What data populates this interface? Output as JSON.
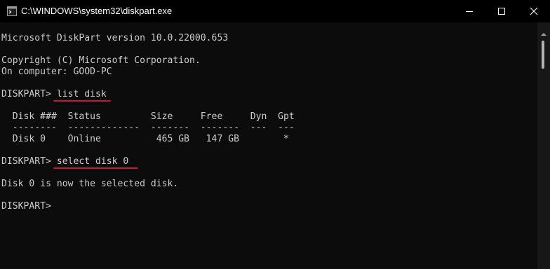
{
  "window": {
    "title": "C:\\WINDOWS\\system32\\diskpart.exe"
  },
  "icons": {
    "app": "console-app-icon",
    "minimize": "minimize-icon",
    "maximize": "maximize-icon",
    "close": "close-icon",
    "scroll_up": "chevron-up-icon"
  },
  "colors": {
    "background": "#0c0c0c",
    "text": "#cccccc",
    "underline_accent": "#c5163b"
  },
  "console": {
    "lines": [
      "Microsoft DiskPart version 10.0.22000.653",
      "",
      "Copyright (C) Microsoft Corporation.",
      "On computer: GOOD-PC",
      "",
      "DISKPART> list disk",
      "",
      "  Disk ###  Status         Size     Free     Dyn  Gpt",
      "  --------  -------------  -------  -------  ---  ---",
      "  Disk 0    Online          465 GB   147 GB        *",
      "",
      "DISKPART> select disk 0",
      "",
      "Disk 0 is now the selected disk.",
      "",
      "DISKPART>"
    ]
  }
}
